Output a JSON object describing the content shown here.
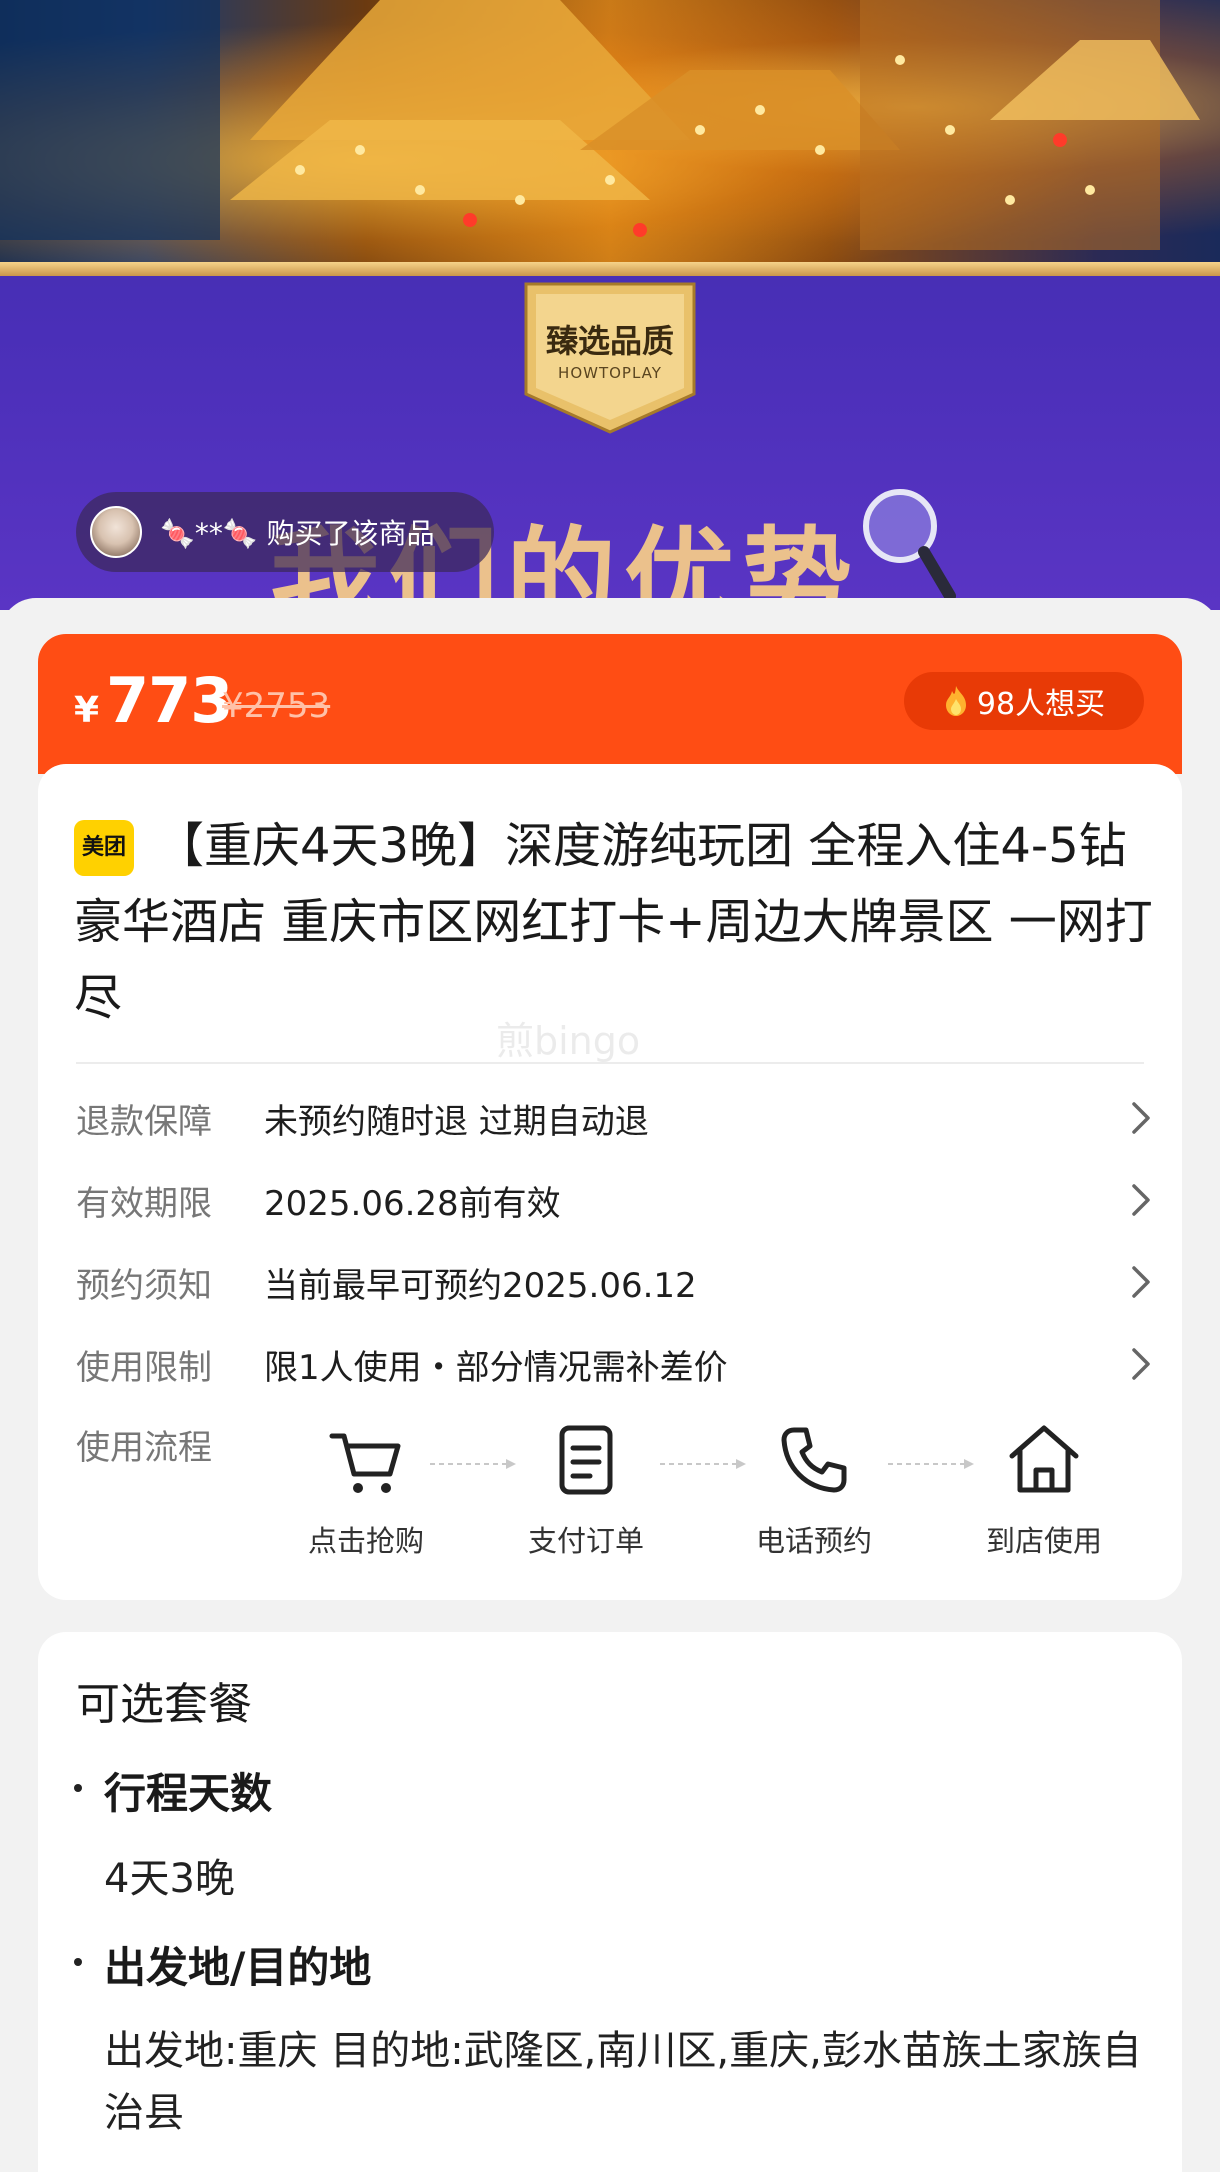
{
  "hero": {
    "badge_title": "臻选品质",
    "badge_subtitle": "HOWTOPLAY",
    "big_text": "我们的优势",
    "buyer_notice": "🍬**🍬 购买了该商品"
  },
  "price": {
    "currency": "¥",
    "current": "773",
    "original": "¥2753",
    "want_count_text": "98人想买"
  },
  "product": {
    "platform_badge": "美团",
    "title": "【重庆4天3晚】深度游纯玩团 全程入住4-5钻豪华酒店 重庆市区网红打卡+周边大牌景区 一网打尽",
    "watermark": "煎bingo"
  },
  "info_rows": [
    {
      "label": "退款保障",
      "value": "未预约随时退 过期自动退"
    },
    {
      "label": "有效期限",
      "value": "2025.06.28前有效"
    },
    {
      "label": "预约须知",
      "value": "当前最早可预约2025.06.12"
    },
    {
      "label": "使用限制",
      "value": "限1人使用・部分情况需补差价"
    }
  ],
  "flow": {
    "label": "使用流程",
    "steps": [
      {
        "label": "点击抢购",
        "icon": "cart-icon"
      },
      {
        "label": "支付订单",
        "icon": "document-icon"
      },
      {
        "label": "电话预约",
        "icon": "phone-icon"
      },
      {
        "label": "到店使用",
        "icon": "home-icon"
      }
    ]
  },
  "packages": {
    "title": "可选套餐",
    "sections": [
      {
        "heading": "行程天数",
        "value": "4天3晚"
      },
      {
        "heading": "出发地/目的地",
        "value": "出发地:重庆 目的地:武隆区,南川区,重庆,彭水苗族土家族自治县"
      }
    ]
  },
  "colors": {
    "accent": "#ff4d14",
    "accent_dark": "#e83a06",
    "badge_yellow": "#ffd100",
    "hero_purple": "#4a2fb8"
  }
}
